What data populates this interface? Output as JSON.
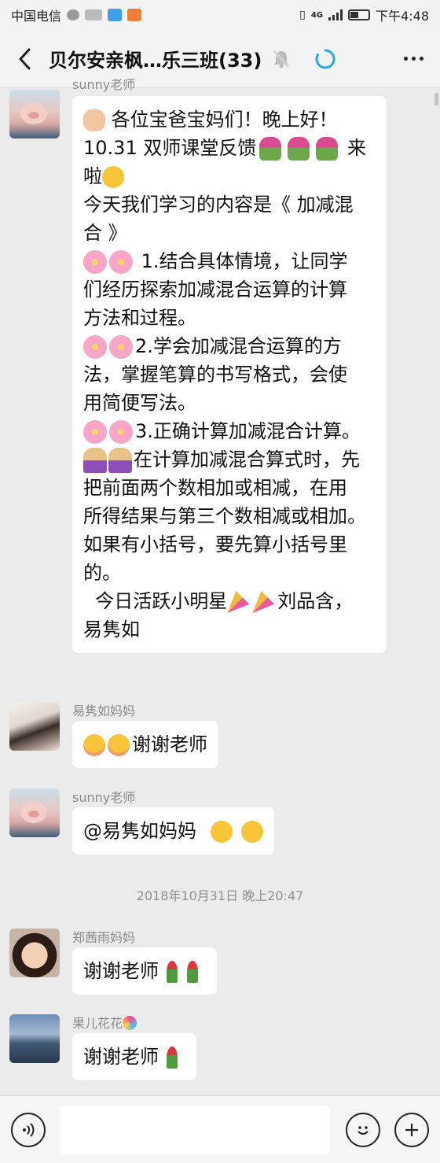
{
  "status_bar": {
    "carrier": "中国电信",
    "network": "4G",
    "time": "下午4:48"
  },
  "header": {
    "title": "贝尔安亲枫…乐三班(33)"
  },
  "messages": [
    {
      "sender": "sunny老师",
      "lines": [
        " 各位宝爸宝妈们！晚上好！",
        "10.31 双师课堂反馈",
        "来",
        "啦",
        "今天我们学习的内容是《 加减混",
        "合 》",
        " 1.结合具体情境，让同学",
        "们经历探索加减混合运算的计算",
        "方法和过程。",
        "2.学会加减混合运算的方",
        "法，掌握笔算的书写格式，会使",
        "用简便写法。",
        "3.正确计算加减混合计算。",
        "在计算加减混合算式时，先",
        "把前面两个数相加或相减，在用",
        "所得结果与第三个数相减或相加。",
        "如果有小括号，要先算小括号里",
        "的。",
        "  今日活跃小明星",
        "刘品含，",
        "易隽如"
      ]
    },
    {
      "sender": "易隽如妈妈",
      "text": "谢谢老师"
    },
    {
      "sender": "sunny老师",
      "text": "@易隽如妈妈"
    },
    {
      "sender": "郑茜雨妈妈",
      "text": "谢谢老师"
    },
    {
      "sender": "果儿花花",
      "text": "谢谢老师"
    }
  ],
  "timestamp": "2018年10月31日 晚上20:47",
  "input": {
    "placeholder": ""
  },
  "icons": {
    "emoji_flower": "cherry-blossom",
    "emoji_bouquet": "bouquet",
    "emoji_rose": "rose",
    "emoji_party": "party-popper"
  }
}
